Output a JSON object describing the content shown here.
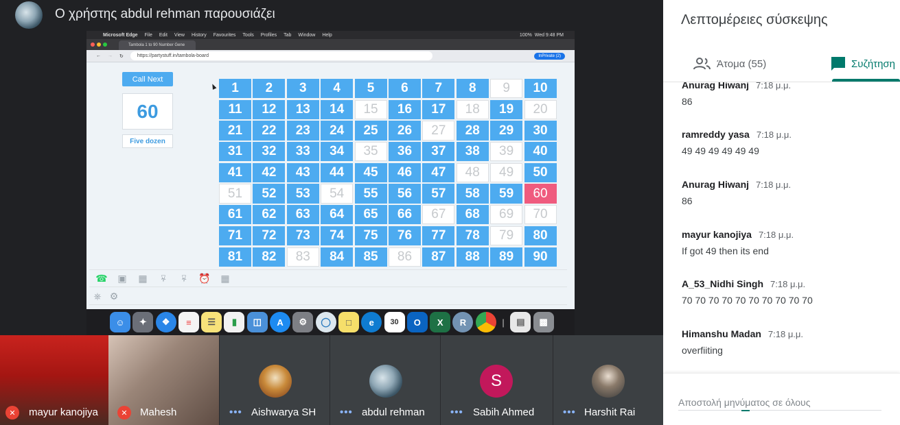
{
  "presenter": {
    "title": "Ο χρήστης abdul rehman παρουσιάζει"
  },
  "shared_screen": {
    "menu_bar": [
      "Microsoft Edge",
      "File",
      "Edit",
      "View",
      "History",
      "Favourites",
      "Tools",
      "Profiles",
      "Tab",
      "Window",
      "Help"
    ],
    "clock": "Wed 9:48 PM",
    "battery": "100%",
    "tab_title": "Tambola 1 to 90 Number Gene",
    "url": "https://partystuff.in/tambola-board",
    "inprivate": "InPrivate (2)",
    "call_next_label": "Call Next",
    "current_number": "60",
    "current_words": "Five dozen",
    "board": [
      {
        "n": "1",
        "s": "called"
      },
      {
        "n": "2",
        "s": "called"
      },
      {
        "n": "3",
        "s": "called"
      },
      {
        "n": "4",
        "s": "called"
      },
      {
        "n": "5",
        "s": "called"
      },
      {
        "n": "6",
        "s": "called"
      },
      {
        "n": "7",
        "s": "called"
      },
      {
        "n": "8",
        "s": "called"
      },
      {
        "n": "9",
        "s": "off"
      },
      {
        "n": "10",
        "s": "called"
      },
      {
        "n": "11",
        "s": "called"
      },
      {
        "n": "12",
        "s": "called"
      },
      {
        "n": "13",
        "s": "called"
      },
      {
        "n": "14",
        "s": "called"
      },
      {
        "n": "15",
        "s": "off"
      },
      {
        "n": "16",
        "s": "called"
      },
      {
        "n": "17",
        "s": "called"
      },
      {
        "n": "18",
        "s": "off"
      },
      {
        "n": "19",
        "s": "called"
      },
      {
        "n": "20",
        "s": "off"
      },
      {
        "n": "21",
        "s": "called"
      },
      {
        "n": "22",
        "s": "called"
      },
      {
        "n": "23",
        "s": "called"
      },
      {
        "n": "24",
        "s": "called"
      },
      {
        "n": "25",
        "s": "called"
      },
      {
        "n": "26",
        "s": "called"
      },
      {
        "n": "27",
        "s": "off"
      },
      {
        "n": "28",
        "s": "called"
      },
      {
        "n": "29",
        "s": "called"
      },
      {
        "n": "30",
        "s": "called"
      },
      {
        "n": "31",
        "s": "called"
      },
      {
        "n": "32",
        "s": "called"
      },
      {
        "n": "33",
        "s": "called"
      },
      {
        "n": "34",
        "s": "called"
      },
      {
        "n": "35",
        "s": "off"
      },
      {
        "n": "36",
        "s": "called"
      },
      {
        "n": "37",
        "s": "called"
      },
      {
        "n": "38",
        "s": "called"
      },
      {
        "n": "39",
        "s": "off"
      },
      {
        "n": "40",
        "s": "called"
      },
      {
        "n": "41",
        "s": "called"
      },
      {
        "n": "42",
        "s": "called"
      },
      {
        "n": "43",
        "s": "called"
      },
      {
        "n": "44",
        "s": "called"
      },
      {
        "n": "45",
        "s": "called"
      },
      {
        "n": "46",
        "s": "called"
      },
      {
        "n": "47",
        "s": "called"
      },
      {
        "n": "48",
        "s": "off"
      },
      {
        "n": "49",
        "s": "off"
      },
      {
        "n": "50",
        "s": "called"
      },
      {
        "n": "51",
        "s": "off"
      },
      {
        "n": "52",
        "s": "called"
      },
      {
        "n": "53",
        "s": "called"
      },
      {
        "n": "54",
        "s": "off"
      },
      {
        "n": "55",
        "s": "called"
      },
      {
        "n": "56",
        "s": "called"
      },
      {
        "n": "57",
        "s": "called"
      },
      {
        "n": "58",
        "s": "called"
      },
      {
        "n": "59",
        "s": "called"
      },
      {
        "n": "60",
        "s": "current"
      },
      {
        "n": "61",
        "s": "called"
      },
      {
        "n": "62",
        "s": "called"
      },
      {
        "n": "63",
        "s": "called"
      },
      {
        "n": "64",
        "s": "called"
      },
      {
        "n": "65",
        "s": "called"
      },
      {
        "n": "66",
        "s": "called"
      },
      {
        "n": "67",
        "s": "off"
      },
      {
        "n": "68",
        "s": "called"
      },
      {
        "n": "69",
        "s": "off"
      },
      {
        "n": "70",
        "s": "off"
      },
      {
        "n": "71",
        "s": "called"
      },
      {
        "n": "72",
        "s": "called"
      },
      {
        "n": "73",
        "s": "called"
      },
      {
        "n": "74",
        "s": "called"
      },
      {
        "n": "75",
        "s": "called"
      },
      {
        "n": "76",
        "s": "called"
      },
      {
        "n": "77",
        "s": "called"
      },
      {
        "n": "78",
        "s": "called"
      },
      {
        "n": "79",
        "s": "off"
      },
      {
        "n": "80",
        "s": "called"
      },
      {
        "n": "81",
        "s": "called"
      },
      {
        "n": "82",
        "s": "called"
      },
      {
        "n": "83",
        "s": "off"
      },
      {
        "n": "84",
        "s": "called"
      },
      {
        "n": "85",
        "s": "called"
      },
      {
        "n": "86",
        "s": "off"
      },
      {
        "n": "87",
        "s": "called"
      },
      {
        "n": "88",
        "s": "called"
      },
      {
        "n": "89",
        "s": "called"
      },
      {
        "n": "90",
        "s": "called"
      }
    ]
  },
  "participants": [
    {
      "name": "mayur kanojiya",
      "muted": true
    },
    {
      "name": "Mahesh",
      "muted": true
    },
    {
      "name": "Aishwarya SH",
      "muted": false
    },
    {
      "name": "abdul rehman",
      "muted": false
    },
    {
      "name": "Sabih Ahmed",
      "muted": false,
      "initial": "S"
    },
    {
      "name": "Harshit Rai",
      "muted": false
    }
  ],
  "panel": {
    "title": "Λεπτομέρειες σύσκεψης",
    "tab_people": "Άτομα (55)",
    "tab_chat": "Συζήτηση",
    "compose_placeholder": "Αποστολή μηνύματος σε όλους"
  },
  "messages": [
    {
      "sender": "Anurag Hiwanj",
      "time": "7:18 μ.μ.",
      "text": "86"
    },
    {
      "sender": "ramreddy yasa",
      "time": "7:18 μ.μ.",
      "text": "49 49 49 49 49 49"
    },
    {
      "sender": "Anurag Hiwanj",
      "time": "7:18 μ.μ.",
      "text": "86"
    },
    {
      "sender": "mayur kanojiya",
      "time": "7:18 μ.μ.",
      "text": "If got 49 then its end"
    },
    {
      "sender": "A_53_Nidhi Singh",
      "time": "7:18 μ.μ.",
      "text": "70 70 70 70 70 70 70 70 70 70"
    },
    {
      "sender": "Himanshu Madan",
      "time": "7:18 μ.μ.",
      "text": "overfiiting"
    }
  ],
  "colors": {
    "accent": "#00796b",
    "board_called": "#4dabf0",
    "board_current": "#ef5b7e",
    "mic_off": "#ea4335"
  }
}
